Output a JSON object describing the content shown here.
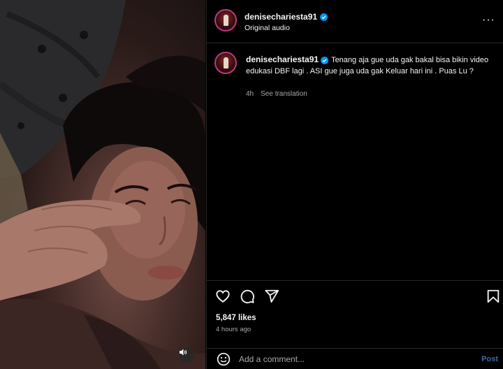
{
  "media": {
    "mute_icon": "speaker-icon"
  },
  "header": {
    "username": "denisechariesta91",
    "subtitle": "Original audio",
    "more_icon": "more-options-icon",
    "more_label": "···"
  },
  "caption": {
    "username": "denisechariesta91",
    "text": "Tenang aja gue uda gak bakal bisa bikin video edukasi DBF lagi . ASI gue juga uda gak Keluar hari ini . Puas Lu ?",
    "age": "4h",
    "see_translation": "See translation"
  },
  "actions": {
    "icons": [
      "heart-icon",
      "comment-icon",
      "share-icon",
      "bookmark-icon"
    ],
    "likes": "5,847 likes",
    "posted": "4 hours ago"
  },
  "comment": {
    "placeholder": "Add a comment...",
    "post_label": "Post"
  },
  "colors": {
    "background": "#000000",
    "text": "#f5f5f5",
    "muted": "#a8a8a8",
    "verified": "#0095f6",
    "post_disabled": "#3a6ea0"
  }
}
